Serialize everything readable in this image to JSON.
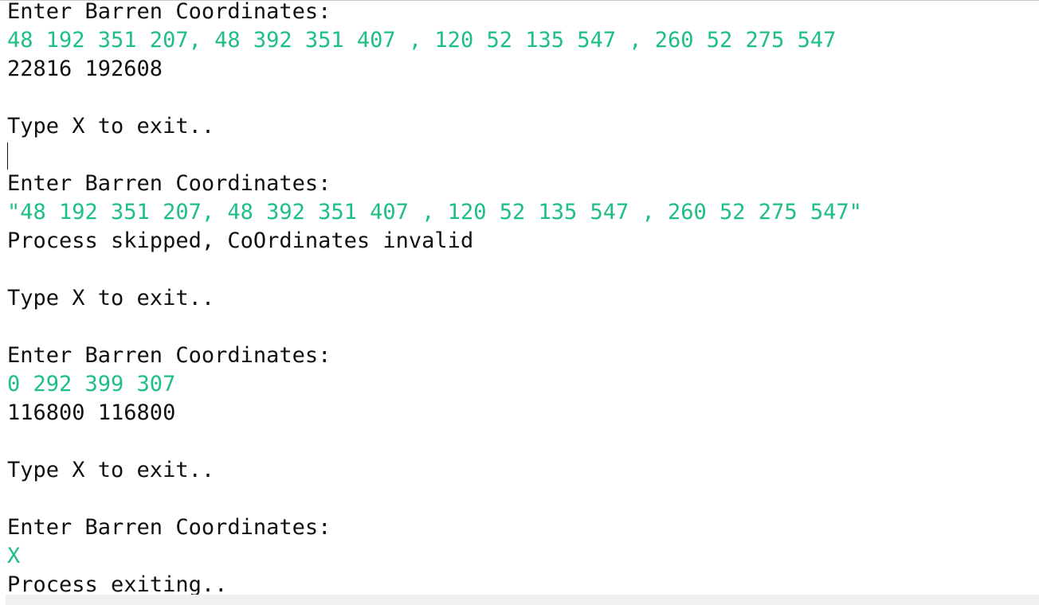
{
  "console": {
    "lines": [
      {
        "text": "Enter Barren Coordinates:",
        "kind": "prompt"
      },
      {
        "text": "48 192 351 207, 48 392 351 407 , 120 52 135 547 , 260 52 275 547",
        "kind": "input"
      },
      {
        "text": "22816 192608",
        "kind": "output"
      },
      {
        "text": "",
        "kind": "blank"
      },
      {
        "text": "Type X to exit..",
        "kind": "prompt"
      },
      {
        "text": "",
        "kind": "caret"
      },
      {
        "text": "Enter Barren Coordinates:",
        "kind": "prompt"
      },
      {
        "text": "\"48 192 351 207, 48 392 351 407 , 120 52 135 547 , 260 52 275 547\"",
        "kind": "input"
      },
      {
        "text": "Process skipped, CoOrdinates invalid",
        "kind": "output"
      },
      {
        "text": "",
        "kind": "blank"
      },
      {
        "text": "Type X to exit..",
        "kind": "prompt"
      },
      {
        "text": "",
        "kind": "blank"
      },
      {
        "text": "Enter Barren Coordinates:",
        "kind": "prompt"
      },
      {
        "text": "0 292 399 307",
        "kind": "input"
      },
      {
        "text": "116800 116800",
        "kind": "output"
      },
      {
        "text": "",
        "kind": "blank"
      },
      {
        "text": "Type X to exit..",
        "kind": "prompt"
      },
      {
        "text": "",
        "kind": "blank"
      },
      {
        "text": "Enter Barren Coordinates:",
        "kind": "prompt"
      },
      {
        "text": "X",
        "kind": "input"
      },
      {
        "text": "Process exiting..",
        "kind": "output"
      }
    ]
  },
  "colors": {
    "input_text": "#1dbf83",
    "output_text": "#111111",
    "background": "#ffffff"
  }
}
